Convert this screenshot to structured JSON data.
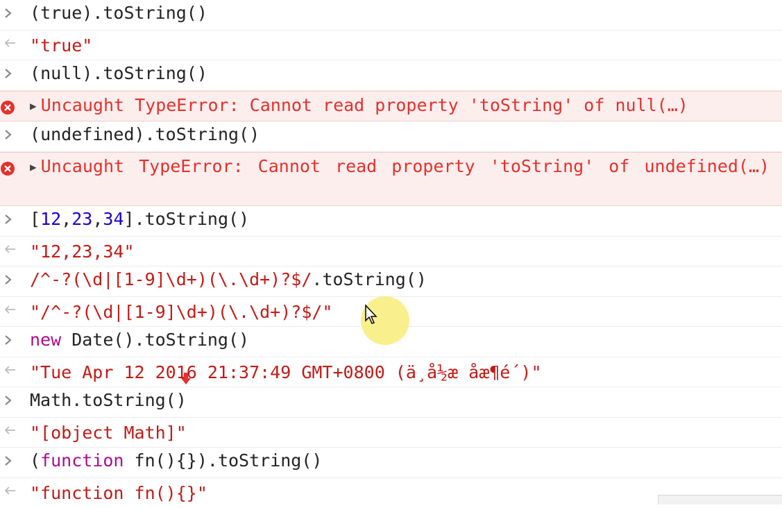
{
  "console": {
    "lines": [
      {
        "type": "in",
        "text": "(true).toString()"
      },
      {
        "type": "out",
        "text": "\"true\""
      },
      {
        "type": "in",
        "text": "(null).toString()"
      },
      {
        "type": "err",
        "text": "Uncaught TypeError: Cannot read property 'toString' of null(…)"
      },
      {
        "type": "in",
        "text": "(undefined).toString()"
      },
      {
        "type": "err",
        "text": "Uncaught TypeError: Cannot read property 'toString' of undefined(…)"
      },
      {
        "type": "in",
        "text": "[12,23,34].toString()"
      },
      {
        "type": "out",
        "text": "\"12,23,34\""
      },
      {
        "type": "in",
        "text": "/^-?(\\d|[1-9]\\d+)(\\.\\d+)?$/.toString()"
      },
      {
        "type": "out",
        "text": "\"/^-?(\\d|[1-9]\\d+)(\\.\\d+)?$/\""
      },
      {
        "type": "in",
        "text": "new Date().toString()"
      },
      {
        "type": "out",
        "text": "\"Tue Apr 12 2016 21:37:49 GMT+0800 (ä¸å½æ åæ¶é´)\""
      },
      {
        "type": "in",
        "text": "Math.toString()"
      },
      {
        "type": "out",
        "text": "\"[object Math]\""
      },
      {
        "type": "in",
        "text": "(function fn(){}).toString()"
      },
      {
        "type": "out",
        "text": "\"function fn(){}\""
      }
    ],
    "parts": {
      "l1_open": "(",
      "l1_kw": "true",
      "l1_rest": ").toString()",
      "l2": "\"true\"",
      "l3_open": "(",
      "l3_kw": "null",
      "l3_rest": ").toString()",
      "l4": "Uncaught TypeError: Cannot read property 'toString' of null(…)",
      "l5_open": "(",
      "l5_kw": "undefined",
      "l5_rest": ").toString()",
      "l6": "Uncaught TypeError: Cannot read property 'toString' of undefined(…)",
      "l7_a": "[",
      "l7_n1": "12",
      "l7_c1": ",",
      "l7_n2": "23",
      "l7_c2": ",",
      "l7_n3": "34",
      "l7_rest": "].toString()",
      "l8": "\"12,23,34\"",
      "l9_re": "/^-?(\\d|[1-9]\\d+)(\\.\\d+)?$/",
      "l9_rest": ".toString()",
      "l10": "\"/^-?(\\d|[1-9]\\d+)(\\.\\d+)?$/\"",
      "l11_kw": "new",
      "l11_rest": " Date().toString()",
      "l12": "\"Tue Apr 12 2016 21:37:49 GMT+0800 (ä¸å½æ åæ¶é´)\"",
      "l13": "Math.toString()",
      "l14": "\"[object Math]\"",
      "l15_open": "(",
      "l15_kw": "function",
      "l15_rest": " fn(){}).toString()",
      "l16": "\"function fn(){}\""
    }
  },
  "colors": {
    "string": "#c41a16",
    "number": "#1c00cf",
    "keyword": "#aa0d91",
    "error_bg": "#fdeeee",
    "error_text": "#e4312b"
  },
  "icons": {
    "input_prompt": "chevron-right-icon",
    "output_prompt": "return-arrow-icon",
    "error": "error-circle-icon",
    "expand": "expand-triangle-icon",
    "cursor": "mouse-pointer-icon"
  }
}
